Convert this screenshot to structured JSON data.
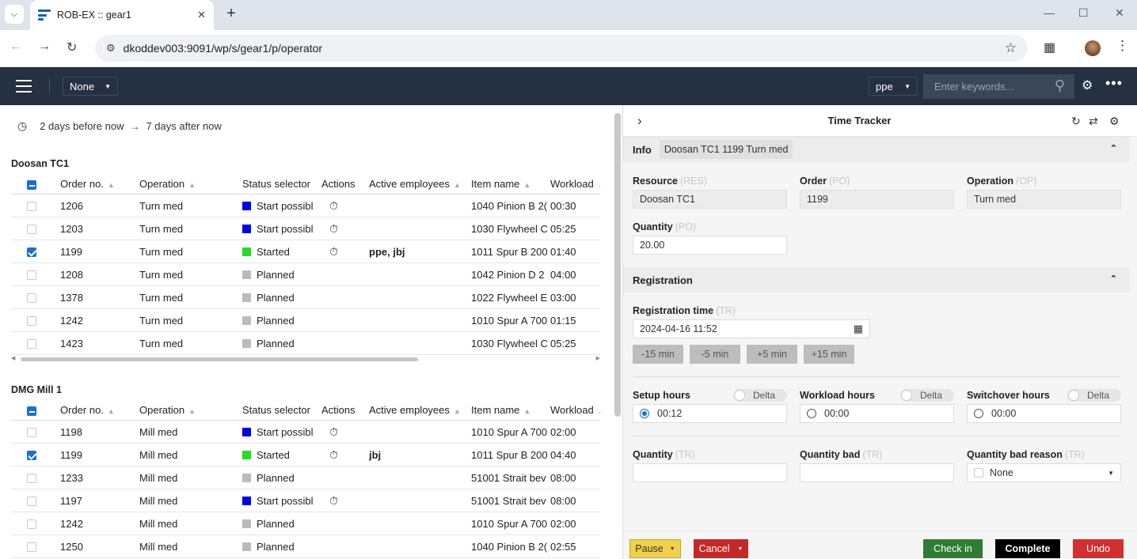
{
  "browser": {
    "tab_title": "ROB-EX :: gear1",
    "url": "dkoddev003:9091/wp/s/gear1/p/operator"
  },
  "appbar": {
    "filter_select": "None",
    "user_select": "ppe",
    "search_placeholder": "Enter keywords..."
  },
  "timespan": {
    "from": "2 days before now",
    "to": "7 days after now"
  },
  "columns": [
    "Order no.",
    "Operation",
    "Status selector",
    "Actions",
    "Active employees",
    "Item name",
    "Workload"
  ],
  "groups": [
    {
      "name": "Doosan TC1",
      "rows": [
        {
          "checked": false,
          "order": "1206",
          "operation": "Turn med",
          "status": "Start possibl",
          "status_color": "#0000ee",
          "timer": true,
          "employees": "",
          "item": "1040 Pinion B 2(",
          "workload": "00:30"
        },
        {
          "checked": false,
          "order": "1203",
          "operation": "Turn med",
          "status": "Start possibl",
          "status_color": "#0000ee",
          "timer": true,
          "employees": "",
          "item": "1030 Flywheel C",
          "workload": "05:25"
        },
        {
          "checked": true,
          "order": "1199",
          "operation": "Turn med",
          "status": "Started",
          "status_color": "#22dd22",
          "timer": true,
          "employees": "ppe, jbj",
          "item": "1011 Spur B 200",
          "workload": "01:40"
        },
        {
          "checked": false,
          "order": "1208",
          "operation": "Turn med",
          "status": "Planned",
          "status_color": "#bbbbbb",
          "timer": false,
          "employees": "",
          "item": "1042 Pinion D 2",
          "workload": "04:00"
        },
        {
          "checked": false,
          "order": "1378",
          "operation": "Turn med",
          "status": "Planned",
          "status_color": "#bbbbbb",
          "timer": false,
          "employees": "",
          "item": "1022 Flywheel E",
          "workload": "03:00"
        },
        {
          "checked": false,
          "order": "1242",
          "operation": "Turn med",
          "status": "Planned",
          "status_color": "#bbbbbb",
          "timer": false,
          "employees": "",
          "item": "1010 Spur A 700",
          "workload": "01:15"
        },
        {
          "checked": false,
          "order": "1423",
          "operation": "Turn med",
          "status": "Planned",
          "status_color": "#bbbbbb",
          "timer": false,
          "employees": "",
          "item": "1030 Flywheel C",
          "workload": "05:25"
        }
      ]
    },
    {
      "name": "DMG Mill 1",
      "rows": [
        {
          "checked": false,
          "order": "1198",
          "operation": "Mill med",
          "status": "Start possibl",
          "status_color": "#0000ee",
          "timer": true,
          "employees": "",
          "item": "1010 Spur A 700",
          "workload": "02:00"
        },
        {
          "checked": true,
          "order": "1199",
          "operation": "Mill med",
          "status": "Started",
          "status_color": "#22dd22",
          "timer": true,
          "employees": "jbj",
          "item": "1011 Spur B 200",
          "workload": "04:40"
        },
        {
          "checked": false,
          "order": "1233",
          "operation": "Mill med",
          "status": "Planned",
          "status_color": "#bbbbbb",
          "timer": false,
          "employees": "",
          "item": "51001 Strait bev",
          "workload": "08:00"
        },
        {
          "checked": false,
          "order": "1197",
          "operation": "Mill med",
          "status": "Start possibl",
          "status_color": "#0000ee",
          "timer": true,
          "employees": "",
          "item": "51001 Strait bev",
          "workload": "08:00"
        },
        {
          "checked": false,
          "order": "1242",
          "operation": "Mill med",
          "status": "Planned",
          "status_color": "#bbbbbb",
          "timer": false,
          "employees": "",
          "item": "1010 Spur A 700",
          "workload": "02:00"
        },
        {
          "checked": false,
          "order": "1250",
          "operation": "Mill med",
          "status": "Planned",
          "status_color": "#bbbbbb",
          "timer": false,
          "employees": "",
          "item": "1040 Pinion B 2(",
          "workload": "02:55"
        }
      ]
    }
  ],
  "tracker": {
    "title": "Time Tracker",
    "info_label": "Info",
    "info_value": "Doosan TC1 1199 Turn med",
    "resource_label": "Resource",
    "resource_abbr": "(RES)",
    "resource_value": "Doosan TC1",
    "order_label": "Order",
    "order_abbr": "(PO)",
    "order_value": "1199",
    "operation_label": "Operation",
    "operation_abbr": "(OP)",
    "operation_value": "Turn med",
    "quantity_label": "Quantity",
    "quantity_abbr": "(PO)",
    "quantity_value": "20.00",
    "registration_label": "Registration",
    "regtime_label": "Registration time",
    "regtime_abbr": "(TR)",
    "regtime_value": "2024-04-16 11:52",
    "offsets": [
      "-15 min",
      "-5 min",
      "+5 min",
      "+15 min"
    ],
    "setup_label": "Setup hours",
    "setup_value": "00:12",
    "workload_label": "Workload hours",
    "workload_value": "00:00",
    "switchover_label": "Switchover hours",
    "switchover_value": "00:00",
    "delta_label": "Delta",
    "qty_label": "Quantity",
    "qty_abbr": "(TR)",
    "qty_bad_label": "Quantity bad",
    "qty_bad_abbr": "(TR)",
    "qty_bad_reason_label": "Quantity bad reason",
    "qty_bad_reason_abbr": "(TR)",
    "qty_bad_reason_value": "None"
  },
  "footer": {
    "pause": "Pause",
    "cancel": "Cancel",
    "checkin": "Check in",
    "complete": "Complete",
    "undo": "Undo"
  },
  "colors": {
    "appbar": "#253140",
    "pause": "#f2d14a",
    "cancel": "#c62828",
    "checkin": "#2e7d32",
    "complete": "#000000",
    "undo": "#d32f2f"
  }
}
